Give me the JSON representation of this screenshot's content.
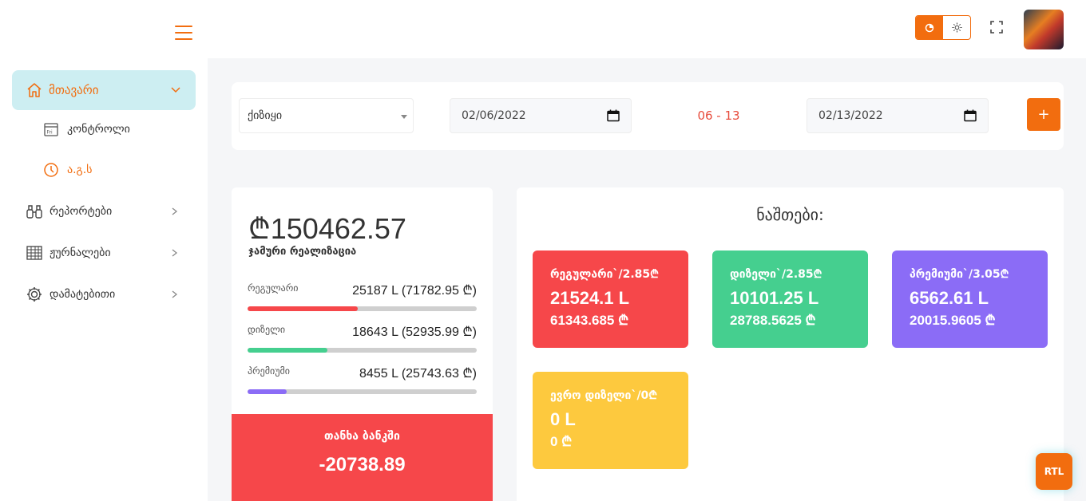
{
  "colors": {
    "accent": "#f26d0f",
    "red": "#f6474a",
    "green": "#45cf8f",
    "purple": "#8b6cf6",
    "yellow": "#fdc93e"
  },
  "sidebar": {
    "menu_icon": "hamburger-icon",
    "main": {
      "label": "მთავარი",
      "icon": "home-icon"
    },
    "sub_items": [
      {
        "label": "კონტროლი",
        "icon": "calendar-icon"
      },
      {
        "label": "ა.გ.ს",
        "icon": "clock-icon"
      }
    ],
    "items": [
      {
        "label": "რეპორტები",
        "icon": "binoculars-icon"
      },
      {
        "label": "ჟურნალები",
        "icon": "table-icon"
      },
      {
        "label": "დამატებითი",
        "icon": "gear-icon"
      }
    ]
  },
  "header": {
    "theme_dark_icon": "moon-icon",
    "theme_light_icon": "sun-icon",
    "fullscreen_icon": "fullscreen-icon"
  },
  "filters": {
    "select_value": "ქიზიყი",
    "date_from": "02/06/2022",
    "range": "06 - 13",
    "date_to": "02/13/2022",
    "add_label": "+"
  },
  "summary": {
    "total": "₾150462.57",
    "total_label": "ჯამური რეალიზაცია",
    "rows": [
      {
        "name": "რეგულარი",
        "amount": "25187 L (71782.95 ₾)",
        "fraction": 0.48,
        "color": "#f6474a"
      },
      {
        "name": "დიზელი",
        "amount": "18643 L (52935.99 ₾)",
        "fraction": 0.35,
        "color": "#45cf8f"
      },
      {
        "name": "პრემიუმი",
        "amount": "8455 L (25743.63 ₾)",
        "fraction": 0.17,
        "color": "#8b6cf6"
      }
    ],
    "bank_label": "თანხა ბანკში",
    "bank_value": "-20738.89"
  },
  "stocks": {
    "title": "ნაშთები:",
    "tiles": [
      {
        "title": "რეგულარი`/2.85₾",
        "liters": "21524.1 L",
        "gel": "61343.685 ₾",
        "color": "#f6474a"
      },
      {
        "title": "დიზელი`/2.85₾",
        "liters": "10101.25 L",
        "gel": "28788.5625 ₾",
        "color": "#45cf8f"
      },
      {
        "title": "პრემიუმი`/3.05₾",
        "liters": "6562.61 L",
        "gel": "20015.9605 ₾",
        "color": "#8b6cf6"
      },
      {
        "title": "ევრო დიზელი`/0₾",
        "liters": "0 L",
        "gel": "0 ₾",
        "color": "#fdc93e"
      }
    ]
  },
  "rtl_label": "RTL"
}
